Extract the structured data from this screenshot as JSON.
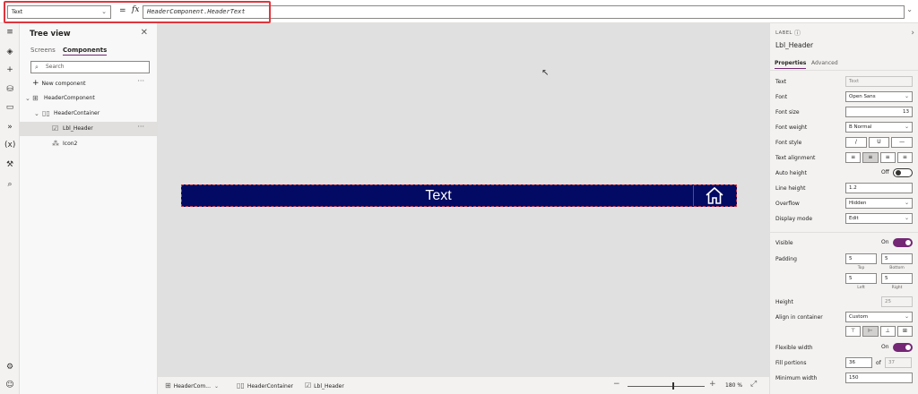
{
  "formula_bar": {
    "property": "Text",
    "equals": "=",
    "fx": "fx",
    "formula": "HeaderComponent.HeaderText"
  },
  "left_rail": {
    "icons": [
      "hamburger-icon",
      "layers-icon",
      "plus-icon",
      "database-icon",
      "media-icon",
      "flow-icon",
      "variables-icon",
      "tools-icon",
      "search-icon",
      "settings-icon",
      "account-icon"
    ]
  },
  "tree_view": {
    "title": "Tree view",
    "tabs": [
      "Screens",
      "Components"
    ],
    "active_tab": "Components",
    "search_placeholder": "Search",
    "new_component": "New component",
    "items": [
      {
        "label": "HeaderComponent",
        "icon": "component-icon",
        "level": 0
      },
      {
        "label": "HeaderContainer",
        "icon": "container-icon",
        "level": 1
      },
      {
        "label": "Lbl_Header",
        "icon": "label-icon",
        "level": 2,
        "selected": true
      },
      {
        "label": "Icon2",
        "icon": "icon-control-icon",
        "level": 1
      }
    ]
  },
  "canvas": {
    "header_text": "Text",
    "header_bg": "#030a63",
    "home_icon": "home-icon"
  },
  "status_bar": {
    "crumbs": [
      "HeaderCom...",
      "HeaderContainer",
      "Lbl_Header"
    ],
    "zoom_minus": "−",
    "zoom_plus": "+",
    "zoom_level": "180 %",
    "zoom_value": 180
  },
  "properties": {
    "control_type": "LABEL",
    "control_name": "Lbl_Header",
    "tabs": [
      "Properties",
      "Advanced"
    ],
    "active_tab": "Properties",
    "text_label": "Text",
    "text_value": "Text",
    "font_label": "Font",
    "font_value": "Open Sans",
    "font_size_label": "Font size",
    "font_size_value": "13",
    "font_weight_label": "Font weight",
    "font_weight_value": "B  Normal",
    "font_style_label": "Font style",
    "font_style_buttons": [
      "/",
      "U",
      "—"
    ],
    "text_alignment_label": "Text alignment",
    "text_alignment_buttons": [
      "≡",
      "≡",
      "≡",
      "≡"
    ],
    "auto_height_label": "Auto height",
    "auto_height_value": "Off",
    "line_height_label": "Line height",
    "line_height_value": "1.2",
    "overflow_label": "Overflow",
    "overflow_value": "Hidden",
    "display_mode_label": "Display mode",
    "display_mode_value": "Edit",
    "visible_label": "Visible",
    "visible_value": "On",
    "padding_label": "Padding",
    "padding_top": "5",
    "padding_bottom": "5",
    "padding_left": "5",
    "padding_right": "5",
    "padding_top_cap": "Top",
    "padding_bottom_cap": "Bottom",
    "padding_left_cap": "Left",
    "padding_right_cap": "Right",
    "height_label": "Height",
    "height_value": "25",
    "align_label": "Align in container",
    "align_value": "Custom",
    "align_buttons": [
      "⊤",
      "⊢",
      "⊥",
      "⊞"
    ],
    "flexible_width_label": "Flexible width",
    "flexible_width_value": "On",
    "fill_portions_label": "Fill portions",
    "fill_portions_value": "36",
    "fill_portions_of": "of",
    "fill_portions_total": "37",
    "min_width_label": "Minimum width",
    "min_width_value": "150"
  },
  "colors": {
    "accent": "#742774",
    "highlight_border": "#e0353d",
    "canvas_bg": "#e1e0e0"
  }
}
